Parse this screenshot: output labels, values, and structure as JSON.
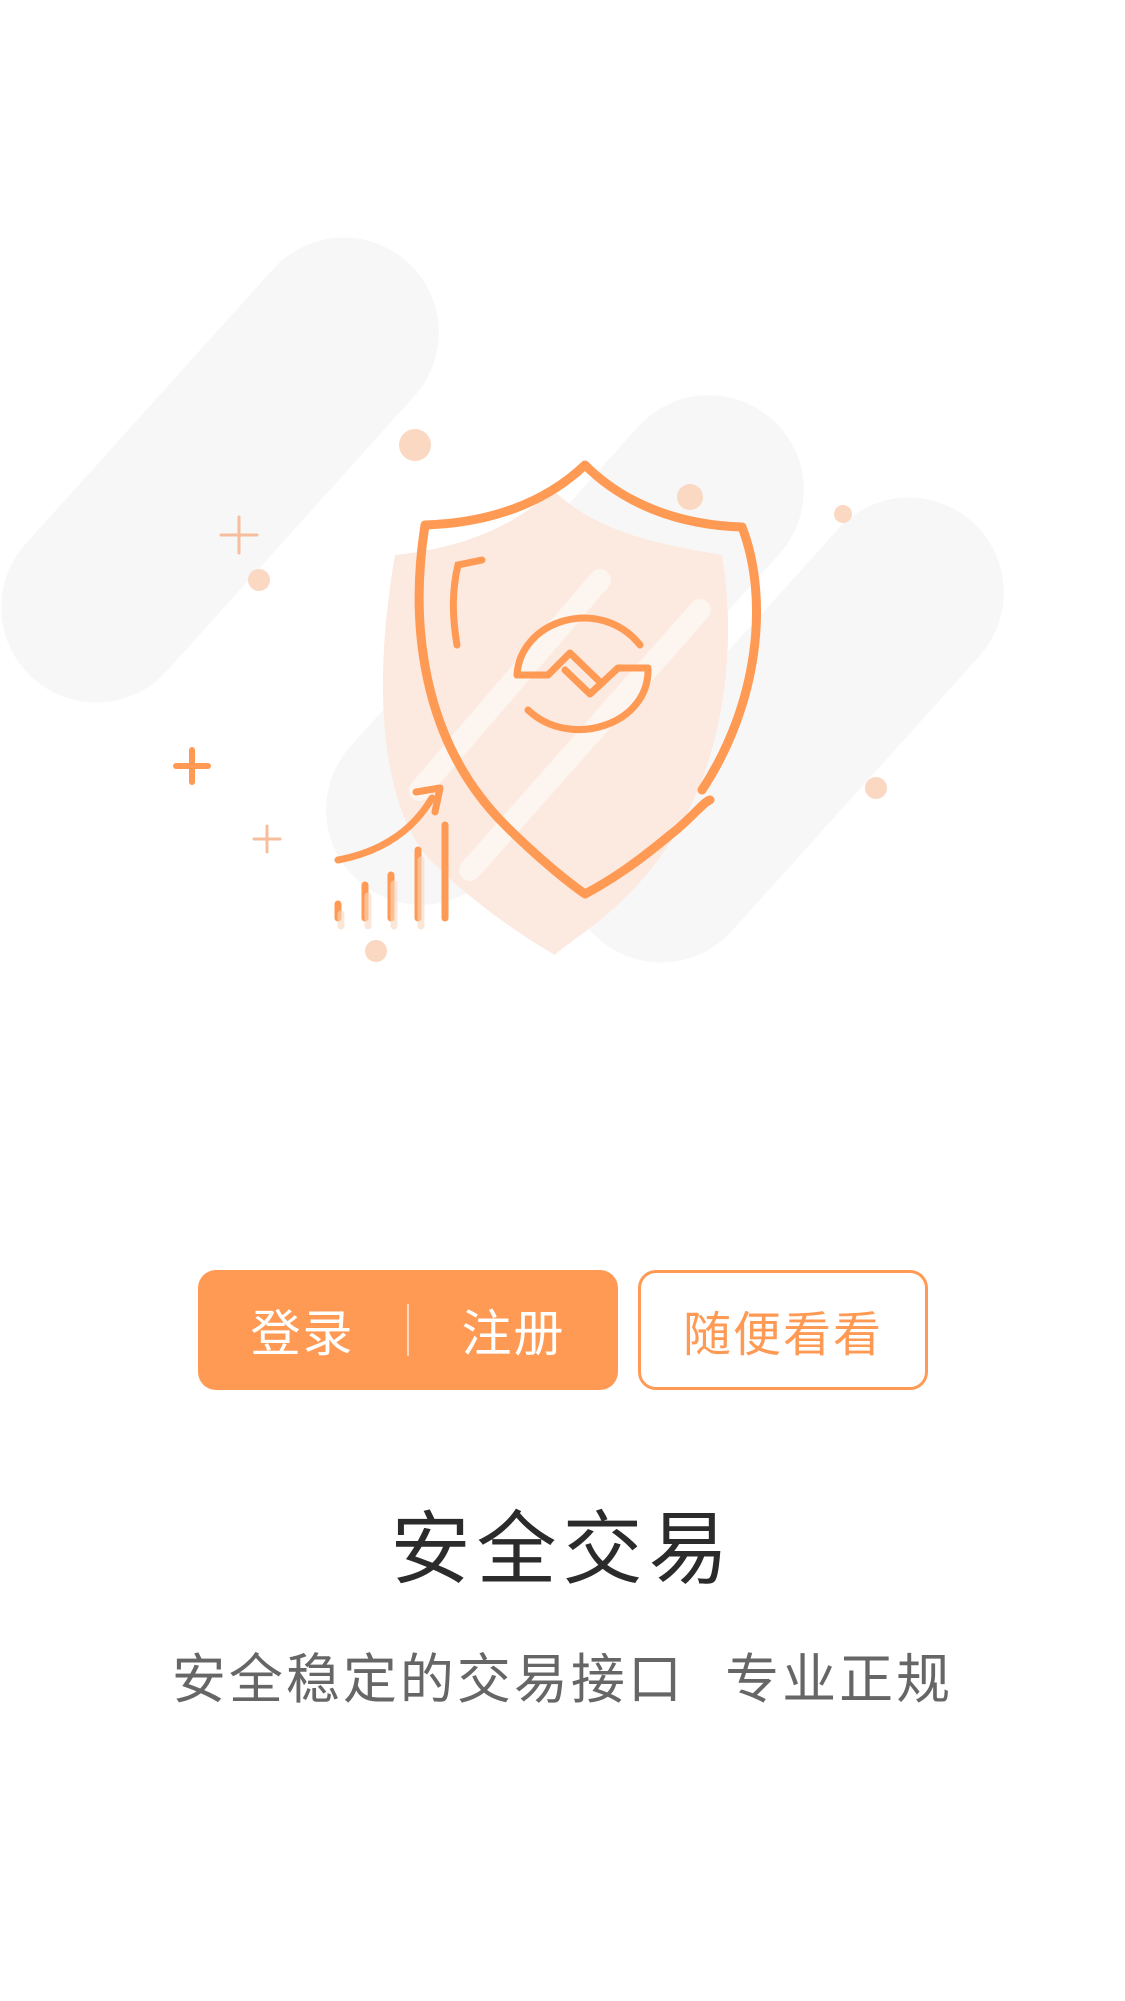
{
  "colors": {
    "accent": "#FF9A55",
    "accent_light": "#FCE9DF",
    "blob_gray": "#F6F6F6",
    "title": "#2B2B2B",
    "subtitle": "#666666"
  },
  "illustration": {
    "icon": "security-shield-icon"
  },
  "buttons": {
    "login_label": "登录",
    "register_label": "注册",
    "browse_label": "随便看看"
  },
  "hero": {
    "title": "安全交易",
    "subtitle": "安全稳定的交易接口  专业正规"
  }
}
